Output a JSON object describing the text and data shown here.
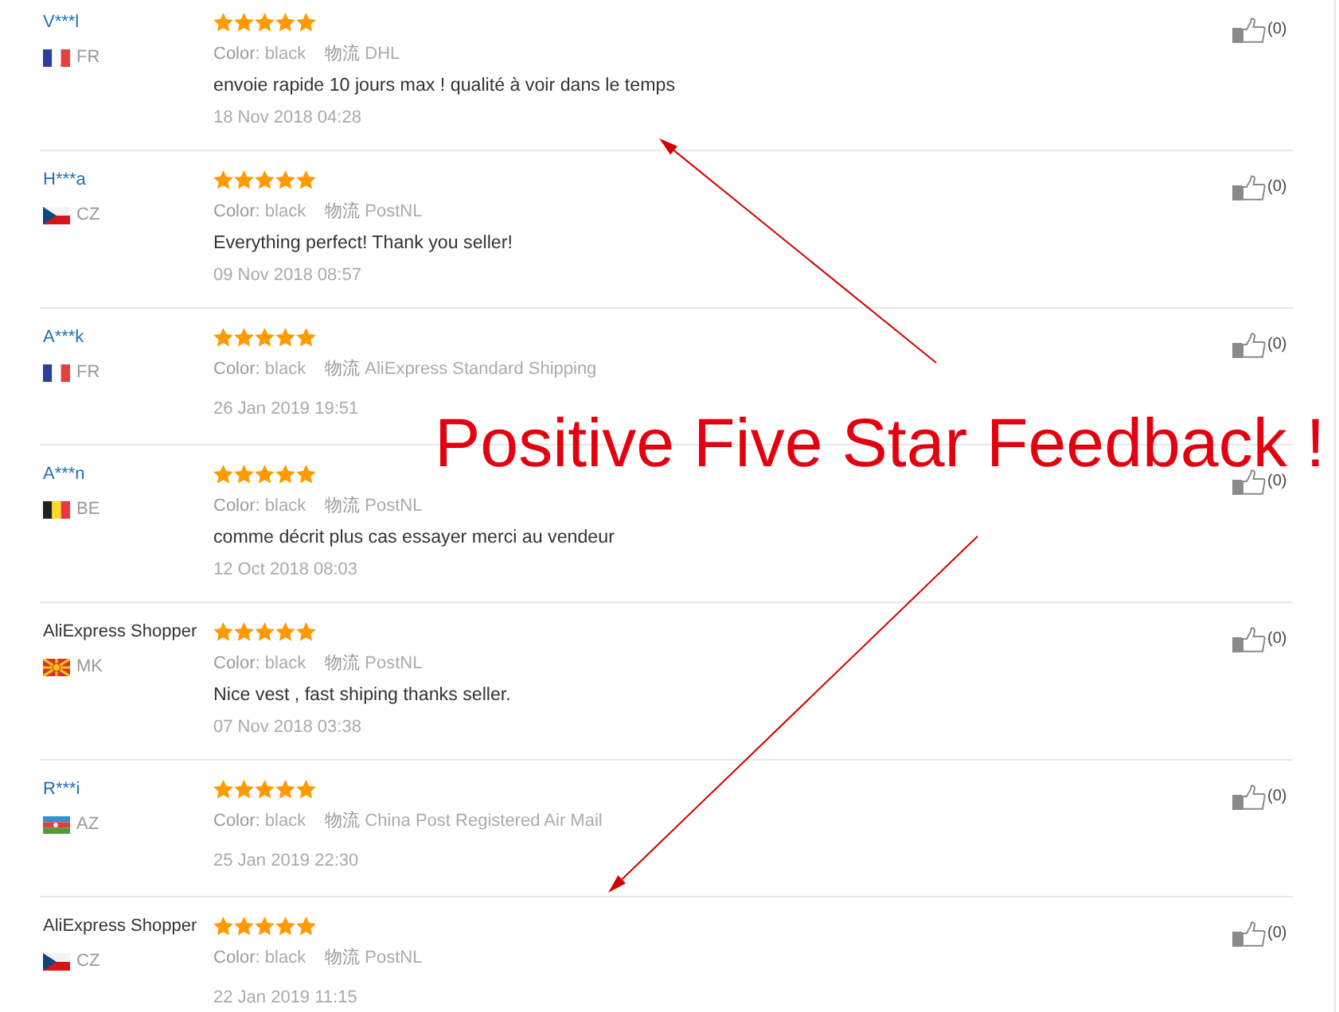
{
  "reviews": [
    {
      "name": "V***l",
      "kind": "masked",
      "flag": {
        "kind": "fr"
      },
      "country": "FR",
      "stars": 5,
      "product_color": {
        "label": "Color:",
        "value": "black"
      },
      "shipping": {
        "label": "物流",
        "value": "DHL"
      },
      "comment": "envoie rapide 10 jours max ! qualité à voir dans le temps",
      "date": "18 Nov 2018 04:28",
      "likes": "(0)"
    },
    {
      "name": "H***a",
      "kind": "masked",
      "flag": {
        "kind": "cz"
      },
      "country": "CZ",
      "stars": 5,
      "product_color": {
        "label": "Color:",
        "value": "black"
      },
      "shipping": {
        "label": "物流",
        "value": "PostNL"
      },
      "comment": "Everything perfect! Thank you seller!",
      "date": "09 Nov 2018 08:57",
      "likes": "(0)"
    },
    {
      "name": "A***k",
      "kind": "masked",
      "flag": {
        "kind": "fr"
      },
      "country": "FR",
      "stars": 5,
      "product_color": {
        "label": "Color:",
        "value": "black"
      },
      "shipping": {
        "label": "物流",
        "value": "AliExpress Standard Shipping"
      },
      "date": "26 Jan 2019 19:51",
      "likes": "(0)"
    },
    {
      "name": "A***n",
      "kind": "masked",
      "flag": {
        "kind": "be"
      },
      "country": "BE",
      "stars": 5,
      "product_color": {
        "label": "Color:",
        "value": "black"
      },
      "shipping": {
        "label": "物流",
        "value": "PostNL"
      },
      "comment": "comme décrit plus cas essayer merci au vendeur",
      "date": "12 Oct 2018 08:03",
      "likes": "(0)"
    },
    {
      "name": "AliExpress Shopper",
      "kind": "shopper",
      "flag": {
        "kind": "mk"
      },
      "country": "MK",
      "stars": 5,
      "product_color": {
        "label": "Color:",
        "value": "black"
      },
      "shipping": {
        "label": "物流",
        "value": "PostNL"
      },
      "comment": "Nice vest , fast shiping thanks seller.",
      "date": "07 Nov 2018 03:38",
      "likes": "(0)"
    },
    {
      "name": "R***i",
      "kind": "masked",
      "flag": {
        "kind": "az"
      },
      "country": "AZ",
      "stars": 5,
      "product_color": {
        "label": "Color:",
        "value": "black"
      },
      "shipping": {
        "label": "物流",
        "value": "China Post Registered Air Mail"
      },
      "date": "25 Jan 2019 22:30",
      "likes": "(0)"
    },
    {
      "name": "AliExpress Shopper",
      "kind": "shopper",
      "flag": {
        "kind": "cz"
      },
      "country": "CZ",
      "stars": 5,
      "product_color": {
        "label": "Color:",
        "value": "black"
      },
      "shipping": {
        "label": "物流",
        "value": "PostNL"
      },
      "date": "22 Jan 2019 11:15",
      "likes": "(0)"
    }
  ],
  "annotation": {
    "text": "Positive Five Star Feedback !"
  }
}
